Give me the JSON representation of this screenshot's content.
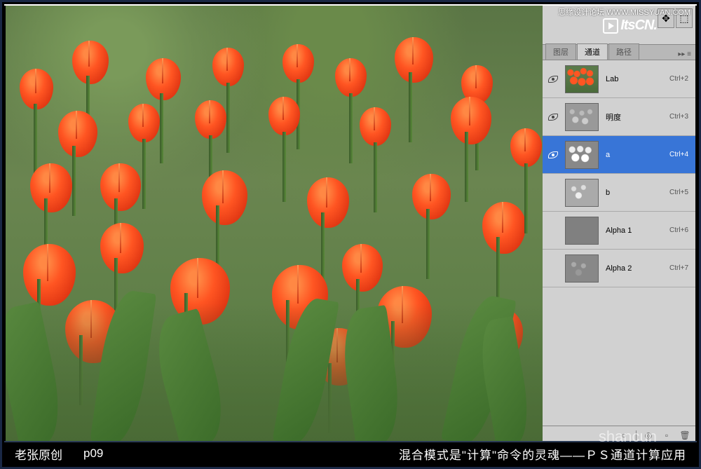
{
  "watermark": {
    "top_text": "思缘设计论坛  WWW.MISSYUAN.COM",
    "logo_text": "ItsCN.",
    "bottom_text": "shancun"
  },
  "panel": {
    "tabs": {
      "layers": "图层",
      "channels": "通道",
      "paths": "路径",
      "menu_glyph": "▸▸ ≡"
    },
    "channels": [
      {
        "name": "Lab",
        "shortcut": "Ctrl+2",
        "visible": true
      },
      {
        "name": "明度",
        "shortcut": "Ctrl+3",
        "visible": true
      },
      {
        "name": "a",
        "shortcut": "Ctrl+4",
        "visible": true
      },
      {
        "name": "b",
        "shortcut": "Ctrl+5",
        "visible": false
      },
      {
        "name": "Alpha 1",
        "shortcut": "Ctrl+6",
        "visible": false
      },
      {
        "name": "Alpha 2",
        "shortcut": "Ctrl+7",
        "visible": false
      }
    ],
    "footer_icons": {
      "load_selection": "○",
      "save_selection": "◎",
      "new_channel": "▫",
      "delete": "🗑"
    }
  },
  "caption": {
    "author": "老张原创",
    "page": "p09",
    "title": "混合模式是\"计算\"命令的灵魂——ＰＳ通道计算应用"
  }
}
